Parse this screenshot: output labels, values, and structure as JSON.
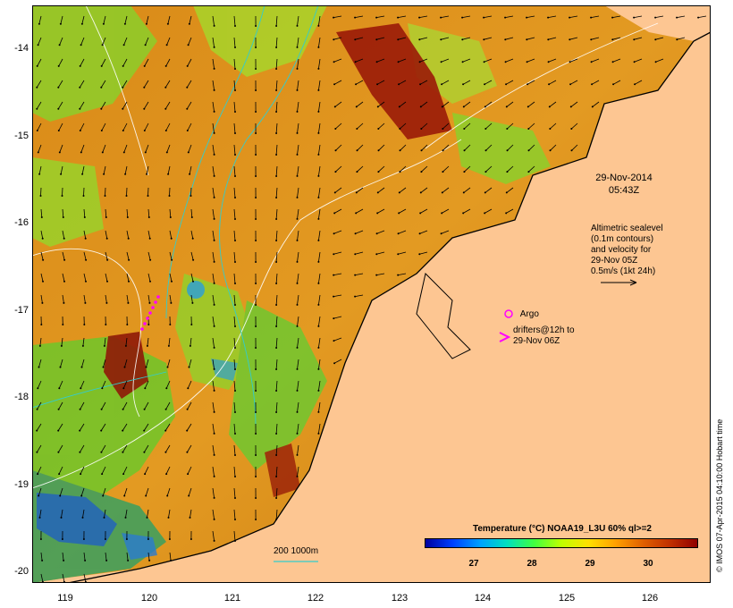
{
  "map": {
    "y_ticks": [
      "-14",
      "-15",
      "-16",
      "-17",
      "-18",
      "-19",
      "-20"
    ],
    "x_ticks": [
      "119",
      "120",
      "121",
      "122",
      "123",
      "124",
      "125",
      "126"
    ],
    "land_color": "#fdc692",
    "coast_color": "#000000",
    "contour_color": "#ffffff",
    "isobath_color": "#33cccc",
    "vector_color": "#000000"
  },
  "annotations": {
    "date": "29-Nov-2014",
    "time": "05:43Z",
    "altimetry_lines": [
      "Altimetric sealevel",
      "(0.1m contours)",
      "and velocity for",
      "29-Nov 05Z",
      "0.5m/s (1kt 24h)"
    ],
    "argo_label": "Argo",
    "argo_icon": "magenta-circle-icon",
    "drifter_lines": [
      "drifters@12h to",
      "29-Nov 06Z"
    ],
    "drifter_icon": "magenta-chevron-icon",
    "depth_legend": "200  1000m",
    "credit": "© IMOS 07-Apr-2015 04:10:00 Hobart time"
  },
  "colorbar": {
    "title": "Temperature (°C) NOAA19_L3U 60% ql>=2",
    "ticks": [
      "27",
      "28",
      "29",
      "30"
    ],
    "colors": [
      "#0000a0",
      "#0040ff",
      "#00a0ff",
      "#00e0c0",
      "#40ff40",
      "#c0ff00",
      "#ffe000",
      "#ffa000",
      "#e06000",
      "#c03000",
      "#900000"
    ]
  }
}
